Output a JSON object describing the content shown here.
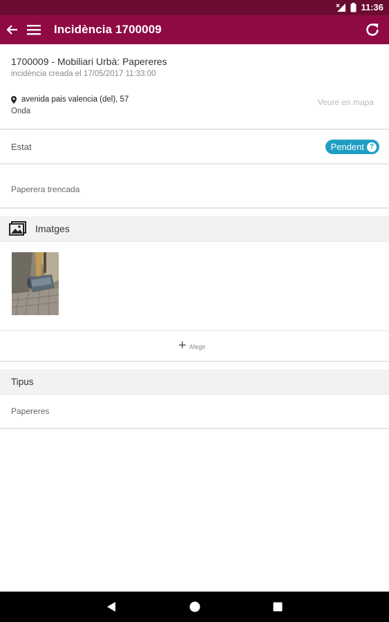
{
  "status_bar": {
    "time": "11:36"
  },
  "app_bar": {
    "title": "Incidència 1700009"
  },
  "incident": {
    "summary": "1700009 - Mobiliari Urbà: Papereres",
    "created": "incidència creada el 17/05/2017 11:33:00",
    "address": "avenida pais valencia (del), 57",
    "city": "Onda",
    "map_link": "Veure en mapa"
  },
  "estat": {
    "label": "Estat",
    "status": "Pendent",
    "help": "?"
  },
  "description": "Paperera trencada",
  "images": {
    "header": "Imatges",
    "add_label": "Afegir",
    "add_icon": "+"
  },
  "tipus": {
    "header": "Tipus",
    "value": "Papereres"
  },
  "colors": {
    "status_bar": "#6b0b32",
    "app_bar": "#8f0a44",
    "badge": "#1f9ec4"
  }
}
